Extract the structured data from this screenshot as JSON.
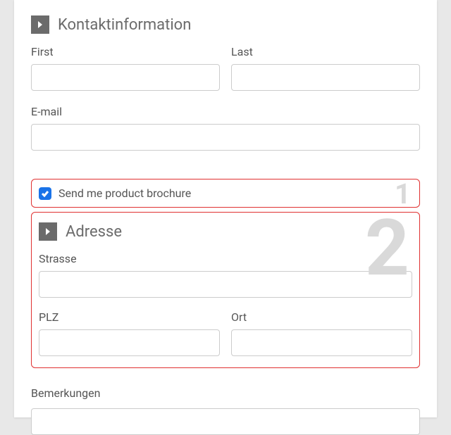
{
  "section_contact": {
    "title": "Kontaktinformation",
    "first_label": "First",
    "last_label": "Last",
    "email_label": "E-mail"
  },
  "brochure": {
    "label": "Send me product brochure",
    "checked": true
  },
  "section_address": {
    "title": "Adresse",
    "street_label": "Strasse",
    "zip_label": "PLZ",
    "city_label": "Ort"
  },
  "remarks": {
    "label": "Bemerkungen"
  },
  "callouts": {
    "one": "1",
    "two": "2"
  }
}
